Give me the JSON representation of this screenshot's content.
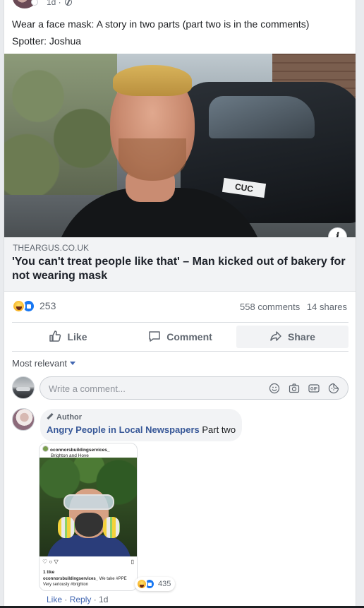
{
  "post": {
    "time": "1d ·",
    "text_line1": "Wear a face mask: A story in two parts (part two is in the comments)",
    "text_line2": "Spotter: Joshua",
    "photo": {
      "plate_text": "CUC"
    },
    "link": {
      "domain": "THEARGUS.CO.UK",
      "title": "'You can't treat people like that' – Man kicked out of bakery for not wearing mask"
    },
    "reactions": {
      "count": "253",
      "types": [
        "haha",
        "like"
      ]
    },
    "stats": {
      "comments": "558 comments",
      "shares": "14 shares"
    },
    "actions": {
      "like": "Like",
      "comment": "Comment",
      "share": "Share"
    }
  },
  "comments": {
    "sort_label": "Most relevant",
    "input_placeholder": "Write a comment...",
    "items": [
      {
        "badge": "Author",
        "name": "Angry People in Local Newspapers",
        "text": "Part two",
        "image": {
          "username": "oconnorsbuildingservices_",
          "location": "Brighton and Hove",
          "likes": "1 like",
          "caption_user": "oconnorsbuildingservices_",
          "caption_text": "We take #PPE Very seriously #brighton"
        },
        "reaction_count": "435",
        "like_label": "Like",
        "reply_label": "Reply",
        "time": "1d"
      }
    ]
  },
  "colors": {
    "link_blue": "#385898",
    "like_blue": "#1877f2",
    "text_gray": "#606770"
  }
}
